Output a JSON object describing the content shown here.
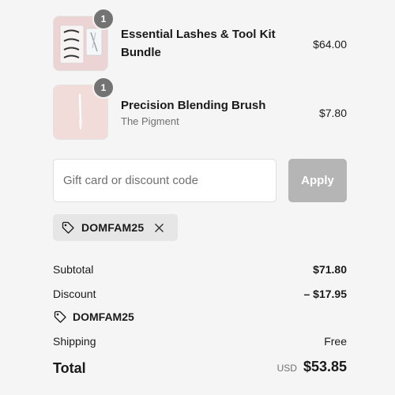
{
  "line_items": [
    {
      "quantity": "1",
      "name": "Essential Lashes & Tool Kit Bundle",
      "vendor": "",
      "price": "$64.00",
      "thumbnail_icon": "lash-kit-image"
    },
    {
      "quantity": "1",
      "name": "Precision Blending Brush",
      "vendor": "The Pigment",
      "price": "$7.80",
      "thumbnail_icon": "brush-image"
    }
  ],
  "discount": {
    "placeholder": "Gift card or discount code",
    "value": "",
    "apply_label": "Apply",
    "applied_code": "DOMFAM25"
  },
  "summary": {
    "subtotal_label": "Subtotal",
    "subtotal_value": "$71.80",
    "discount_label": "Discount",
    "discount_value": "– $17.95",
    "discount_code": "DOMFAM25",
    "shipping_label": "Shipping",
    "shipping_value": "Free",
    "total_label": "Total",
    "total_currency": "USD",
    "total_value": "$53.85"
  },
  "colors": {
    "page_background": "#f5f5f5",
    "badge": "#737373",
    "apply_disabled": "#b5b5b5",
    "chip_background": "#e6e6e6",
    "thumb_pink": "#f0dada"
  }
}
